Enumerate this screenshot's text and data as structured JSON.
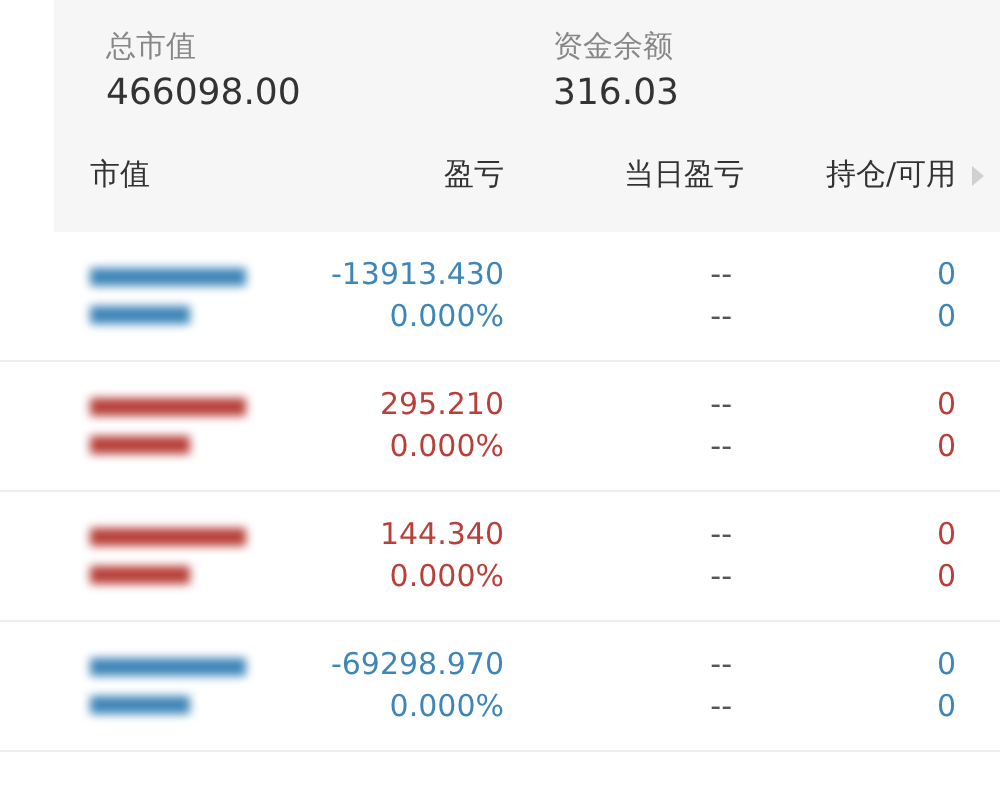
{
  "summary": [
    {
      "label": "总市值",
      "value": "466098.00"
    },
    {
      "label": "资金余额",
      "value": "316.03"
    }
  ],
  "table": {
    "columns": [
      "市值",
      "盈亏",
      "当日盈亏",
      "持仓/可用"
    ],
    "rows": [
      {
        "color": "#3f86b8",
        "profit": "-13913.430",
        "profit_pct": "0.000%",
        "today": "--",
        "today_pct": "--",
        "holding": "0",
        "available": "0"
      },
      {
        "color": "#b8403a",
        "profit": "295.210",
        "profit_pct": "0.000%",
        "today": "--",
        "today_pct": "--",
        "holding": "0",
        "available": "0"
      },
      {
        "color": "#b8403a",
        "profit": "144.340",
        "profit_pct": "0.000%",
        "today": "--",
        "today_pct": "--",
        "holding": "0",
        "available": "0"
      },
      {
        "color": "#3f86b8",
        "profit": "-69298.970",
        "profit_pct": "0.000%",
        "today": "--",
        "today_pct": "--",
        "holding": "0",
        "available": "0"
      }
    ]
  }
}
